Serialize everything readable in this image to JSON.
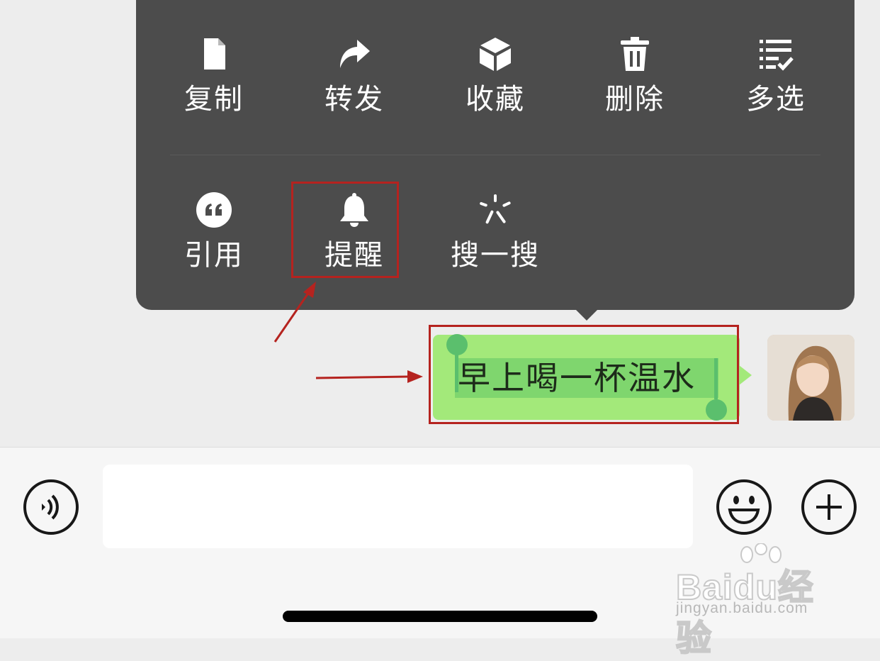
{
  "menu": {
    "row1": [
      {
        "label": "复制",
        "icon": "copy-file-icon"
      },
      {
        "label": "转发",
        "icon": "forward-arrow-icon"
      },
      {
        "label": "收藏",
        "icon": "favorite-cube-icon"
      },
      {
        "label": "删除",
        "icon": "trash-icon"
      },
      {
        "label": "多选",
        "icon": "multi-select-list-icon"
      }
    ],
    "row2": [
      {
        "label": "引用",
        "icon": "quote-icon"
      },
      {
        "label": "提醒",
        "icon": "bell-icon"
      },
      {
        "label": "搜一搜",
        "icon": "search-spark-icon"
      }
    ]
  },
  "message": {
    "text": "早上喝一杯温水",
    "sender": "self"
  },
  "input": {
    "value": "",
    "placeholder": ""
  },
  "icons": {
    "voice": "voice-icon",
    "emoji": "emoji-icon",
    "more": "plus-icon"
  },
  "watermark": {
    "brand": "Baidu经验",
    "url": "jingyan.baidu.com"
  },
  "colors": {
    "menu_bg": "#4c4c4c",
    "bubble": "#a3e97a",
    "selection": "#7fd66e",
    "caret": "#5bbf6d",
    "annotation": "#b5231f",
    "chat_bg": "#ededed",
    "input_bar_bg": "#f6f6f6"
  }
}
